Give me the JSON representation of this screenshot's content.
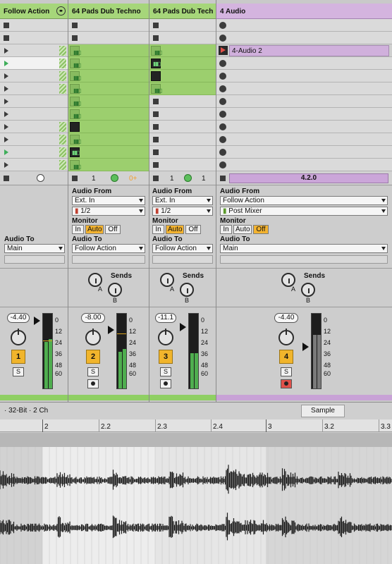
{
  "tracks": [
    {
      "name": "Follow Action",
      "color": "#a6d67a",
      "audio_from": "",
      "input_channel": "",
      "monitor": [],
      "audio_to": "Main",
      "volume": "",
      "number": ""
    },
    {
      "name": "64 Pads Dub Techno",
      "color": "#a6d67a",
      "audio_from": "Ext. In",
      "input_channel": "1/2",
      "monitor": [
        "In",
        "Auto",
        "Off"
      ],
      "monitor_active": "Auto",
      "audio_to": "Follow Action",
      "volume": "-8.00",
      "number": "2",
      "status_count": "1",
      "status_extra": "0+"
    },
    {
      "name": "64 Pads Dub Tech",
      "color": "#a6d67a",
      "audio_from": "Ext. In",
      "input_channel": "1/2",
      "monitor": [
        "In",
        "Auto",
        "Off"
      ],
      "monitor_active": "Auto",
      "audio_to": "Follow Action",
      "volume": "-11.1",
      "number": "3",
      "status_count": "1",
      "status_extra": "1"
    },
    {
      "name": "4 Audio",
      "color": "#d4b4df",
      "audio_from": "Follow Action",
      "input_channel": "Post Mixer",
      "monitor": [
        "In",
        "Auto",
        "Off"
      ],
      "monitor_active": "Off",
      "audio_to": "Main",
      "volume": "-4.40",
      "number": "4",
      "clip_name": "4-Audio 2",
      "status_position": "4.2.0"
    }
  ],
  "group_track": {
    "volume": "-4.40",
    "number": "1"
  },
  "labels": {
    "audio_from": "Audio From",
    "monitor": "Monitor",
    "audio_to": "Audio To",
    "sends": "Sends",
    "send_a": "A",
    "send_b": "B",
    "solo": "S"
  },
  "meter_scale": [
    "0",
    "12",
    "24",
    "36",
    "48",
    "60"
  ],
  "clip_view": {
    "info": "· 32-Bit · 2 Ch",
    "tab": "Sample",
    "ruler": [
      "2",
      "2.2",
      "2.3",
      "2.4",
      "3",
      "3.2",
      "3.3"
    ]
  }
}
